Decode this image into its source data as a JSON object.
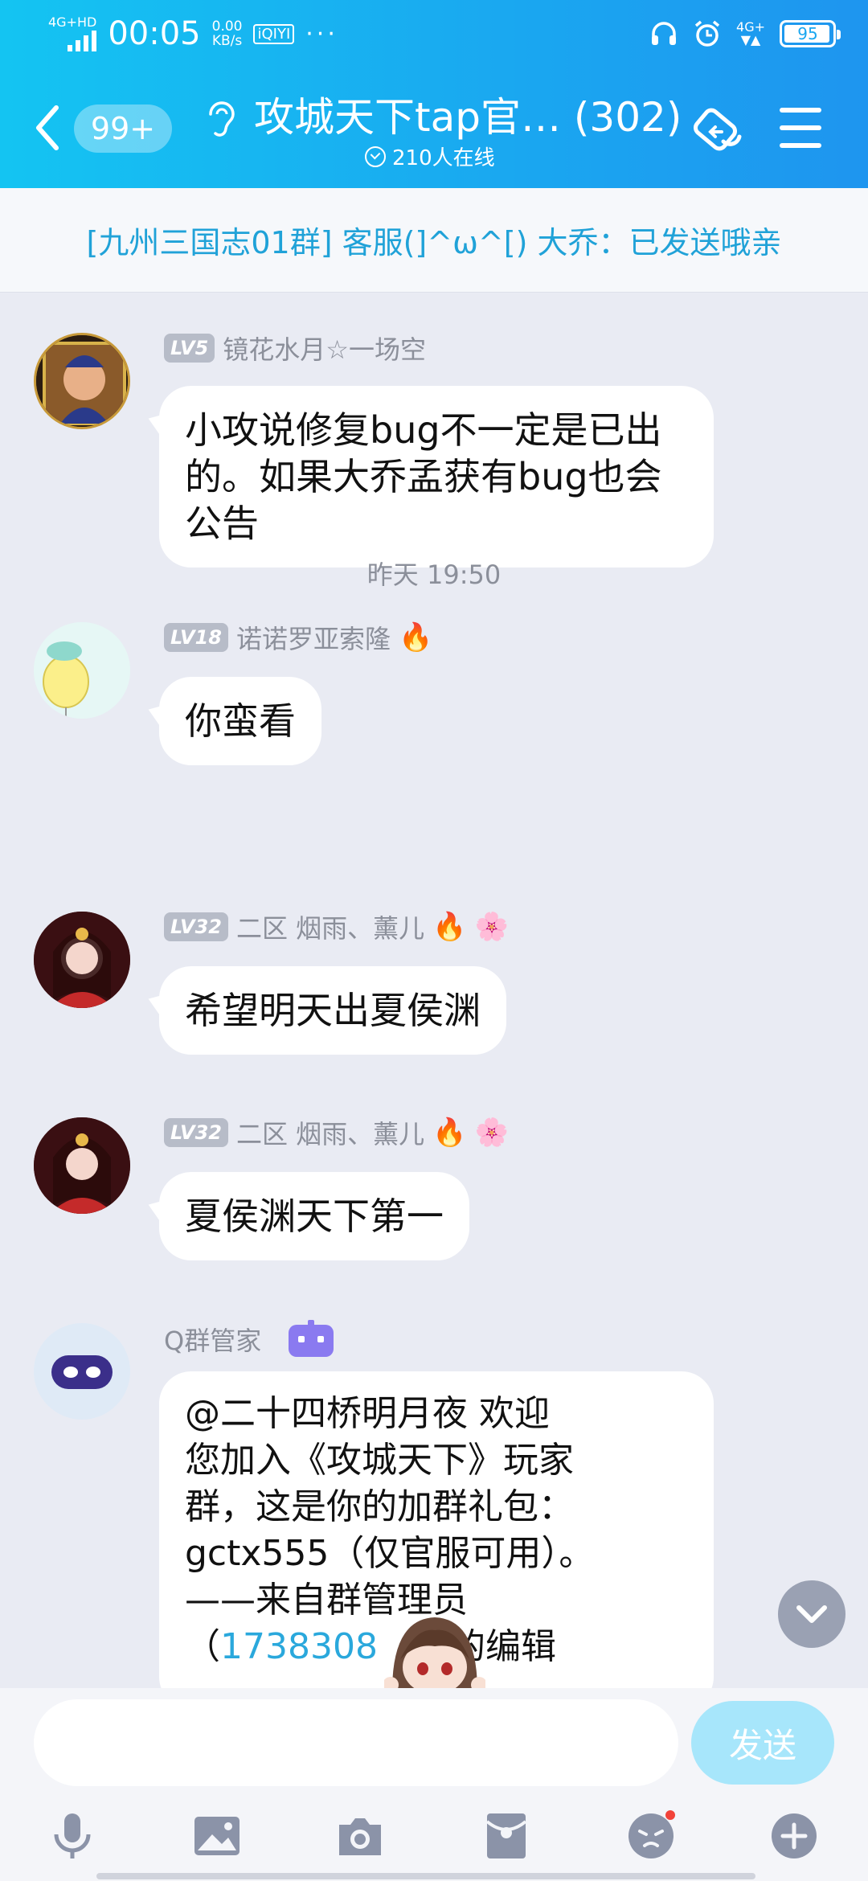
{
  "status_bar": {
    "network": "4G+HD",
    "time": "00:05",
    "speed_value": "0.00",
    "speed_unit": "KB/s",
    "app_badge": "iQIYI",
    "more": "···",
    "network_right": "4G+",
    "battery": "95"
  },
  "header": {
    "unread": "99+",
    "title": "攻城天下tap官… (302)",
    "online": "210人在线"
  },
  "notice": "[九州三国志01群] 客服(]^ω^[) 大乔：已发送哦亲",
  "messages": [
    {
      "level": "LV5",
      "sender": "镜花水月☆一场空",
      "text": "小攻说修复bug不一定是已出的。如果大乔孟获有bug也会公告"
    },
    {
      "level": "LV18",
      "sender": "诺诺罗亚索隆",
      "text": "你蛮看"
    },
    {
      "level": "LV32",
      "sender": "二区 烟雨、薰儿",
      "text": "希望明天出夏侯渊"
    },
    {
      "level": "LV32",
      "sender": "二区 烟雨、薰儿",
      "text": "夏侯渊天下第一"
    },
    {
      "level": "",
      "sender": "Q群管家",
      "text_line1": "@二十四桥明月夜 欢迎",
      "text_line2": "您加入《攻城天下》玩家",
      "text_line3": "群，这是你的加群礼包：",
      "text_line4": "gctx555（仅官服可用）。",
      "text_line5": "——来自群管理员",
      "text_line6_pre": "（",
      "text_line6_link": "1738308",
      "text_line6_post": "的编辑"
    }
  ],
  "timestamp": "昨天 19:50",
  "input": {
    "placeholder": "",
    "send": "发送"
  },
  "colors": {
    "header": "#1aa7f0",
    "accent": "#20a2d8",
    "background": "#e9ebf3"
  }
}
